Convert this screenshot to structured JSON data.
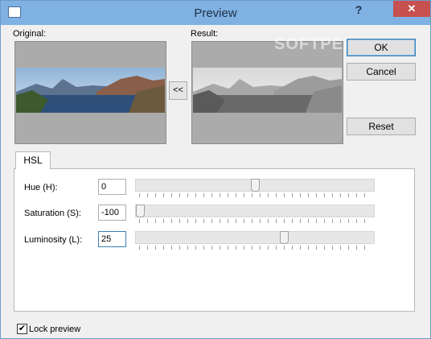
{
  "window": {
    "title": "Preview",
    "help_glyph": "?",
    "close_glyph": "✕"
  },
  "preview": {
    "original_label": "Original:",
    "result_label": "Result:",
    "copy_button_label": "<<"
  },
  "buttons": {
    "ok": "OK",
    "cancel": "Cancel",
    "reset": "Reset"
  },
  "tabs": {
    "active": "HSL"
  },
  "hsl": {
    "hue": {
      "label": "Hue (H):",
      "value": "0",
      "position": 0.5
    },
    "saturation": {
      "label": "Saturation (S):",
      "value": "-100",
      "position": 0.0
    },
    "luminosity": {
      "label": "Luminosity (L):",
      "value": "25",
      "position": 0.625
    }
  },
  "lock_preview": {
    "label": "Lock preview",
    "checked": true,
    "mark": "✔"
  },
  "watermark": "SOFTPEDIA"
}
